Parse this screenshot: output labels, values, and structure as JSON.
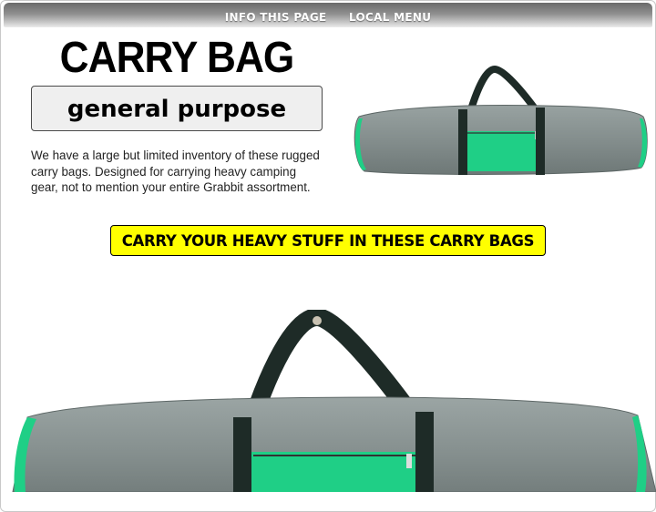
{
  "topnav": {
    "items": [
      {
        "label": "INFO THIS PAGE"
      },
      {
        "label": "LOCAL MENU"
      }
    ]
  },
  "product": {
    "title": "CARRY BAG",
    "subtitle": "general purpose",
    "description": "We have a large but limited inventory of these rugged carry bags. Designed for carrying heavy camping gear, not to mention your entire Grabbit assortment."
  },
  "cta": {
    "label": "CARRY YOUR HEAVY STUFF IN THESE CARRY BAGS"
  },
  "images": {
    "small": {
      "icon": "carry-bag-photo"
    },
    "large": {
      "icon": "carry-bag-photo-closeup"
    }
  },
  "colors": {
    "bag_body": "#858f8e",
    "bag_pocket": "#1fcf86",
    "bag_strap": "#1e2b27",
    "cta_background": "#ffff00"
  }
}
